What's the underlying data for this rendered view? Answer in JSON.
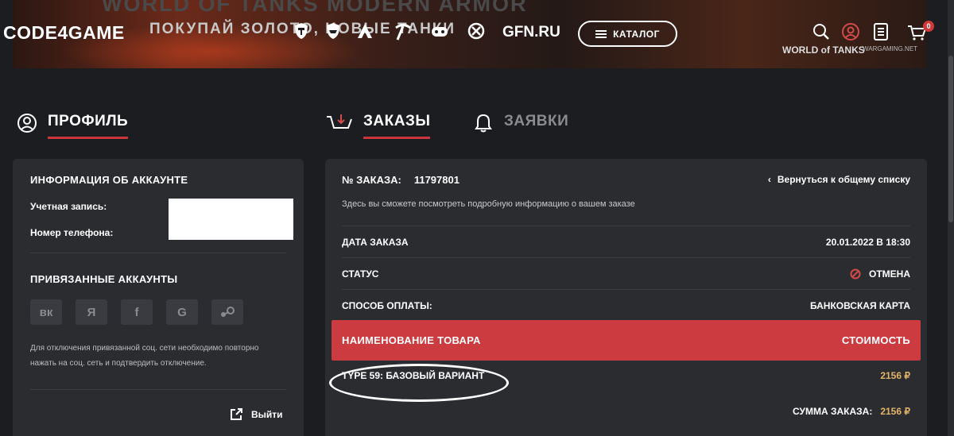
{
  "header": {
    "logo": "CODE4GAME",
    "banner_title": "WORLD OF TANKS MODERN ARMOR",
    "banner_subtitle": "ПОКУПАЙ ЗОЛОТО, НОВЫЕ ТАНКИ",
    "gfn": "GFN.RU",
    "catalog_label": "КАТАЛОГ",
    "wot_logo": "WORLD of TANKS",
    "wg_logo": "WARGAMING.NET",
    "cart_count": "0",
    "brand_color": "#cc3b40"
  },
  "tabs": {
    "profile": "ПРОФИЛЬ",
    "orders": "ЗАКАЗЫ",
    "requests": "ЗАЯВКИ"
  },
  "account": {
    "title": "ИНФОРМАЦИЯ ОБ АККАУНТЕ",
    "account_label": "Учетная запись:",
    "phone_label": "Номер телефона:",
    "linked_title": "ПРИВЯЗАННЫЕ АККАУНТЫ",
    "socials": [
      "вк",
      "Я",
      "f",
      "G",
      "steam"
    ],
    "note": "Для отключения привязанной соц. сети необходимо повторно нажать на соц. сеть и подтвердить отключение.",
    "logout": "Выйти"
  },
  "order": {
    "number_label": "№ ЗАКАЗА:",
    "number": "11797801",
    "back_label": "Вернуться к общему списку",
    "description": "Здесь вы сможете посмотреть подробную информацию о вашем заказе",
    "date_label": "ДАТА ЗАКАЗА",
    "date_value": "20.01.2022 В 18:30",
    "status_label": "СТАТУС",
    "status_value": "ОТМЕНА",
    "payment_label": "СПОСОБ ОПЛАТЫ:",
    "payment_value": "БАНКОВСКАЯ КАРТА",
    "col_name": "НАИМЕНОВАНИЕ ТОВАРА",
    "col_price": "СТОИМОСТЬ",
    "items": [
      {
        "name": "TYPE 59: БАЗОВЫЙ ВАРИАНТ",
        "price": "2156 ₽"
      }
    ],
    "total_label": "СУММА ЗАКАЗА:",
    "total_value": "2156 ₽"
  }
}
